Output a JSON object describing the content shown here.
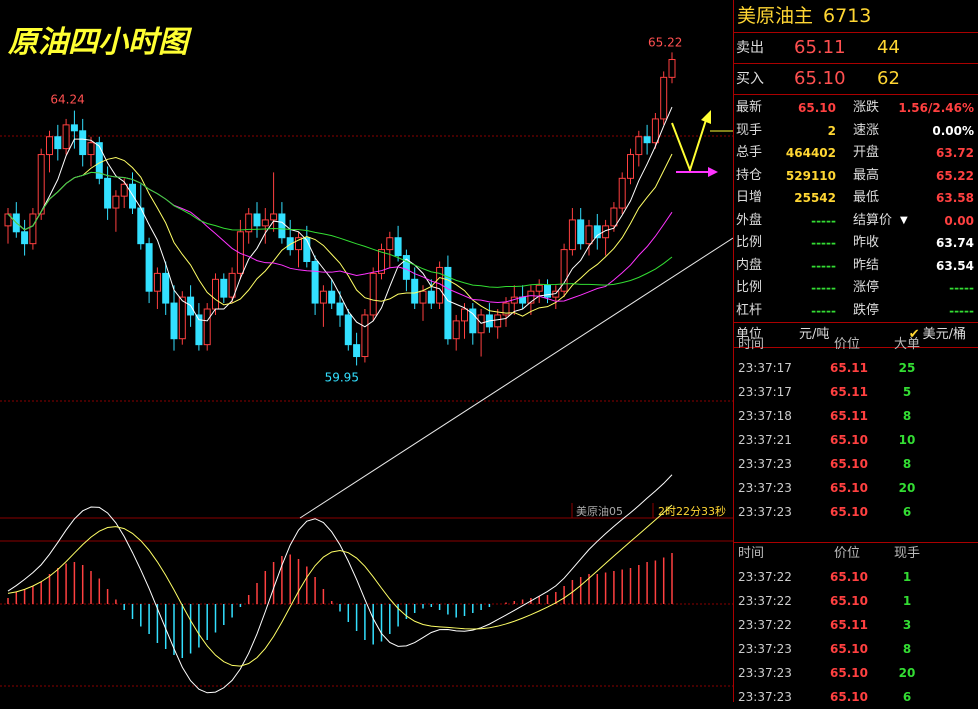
{
  "chart_data": [
    {
      "type": "candlestick",
      "title": "原油四小时图",
      "legend_label": "美原油05",
      "countdown": "2时22分33秒",
      "high_label": "64.24",
      "high2_label": "65.22",
      "low_label": "59.95",
      "candles": [
        [
          62.3,
          62.6,
          62.0,
          62.5
        ],
        [
          62.5,
          62.7,
          62.1,
          62.2
        ],
        [
          62.2,
          62.4,
          61.8,
          62.0
        ],
        [
          62.0,
          62.6,
          61.9,
          62.5
        ],
        [
          62.5,
          63.6,
          62.4,
          63.5
        ],
        [
          63.5,
          63.9,
          63.2,
          63.8
        ],
        [
          63.8,
          64.0,
          63.4,
          63.6
        ],
        [
          63.6,
          64.1,
          63.5,
          64.0
        ],
        [
          64.0,
          64.24,
          63.6,
          63.9
        ],
        [
          63.9,
          64.1,
          63.3,
          63.5
        ],
        [
          63.5,
          63.8,
          63.3,
          63.7
        ],
        [
          63.7,
          63.8,
          63.0,
          63.1
        ],
        [
          63.1,
          63.3,
          62.4,
          62.6
        ],
        [
          62.6,
          62.9,
          62.2,
          62.8
        ],
        [
          62.8,
          63.1,
          62.6,
          63.0
        ],
        [
          63.0,
          63.2,
          62.5,
          62.6
        ],
        [
          62.6,
          63.0,
          61.9,
          62.0
        ],
        [
          62.0,
          62.1,
          61.0,
          61.2
        ],
        [
          61.2,
          61.6,
          60.9,
          61.5
        ],
        [
          61.5,
          61.7,
          60.8,
          61.0
        ],
        [
          61.0,
          61.3,
          60.2,
          60.4
        ],
        [
          60.4,
          61.2,
          60.3,
          61.1
        ],
        [
          61.1,
          61.3,
          60.6,
          60.8
        ],
        [
          60.8,
          61.0,
          60.2,
          60.3
        ],
        [
          60.3,
          61.0,
          60.2,
          60.9
        ],
        [
          60.9,
          61.5,
          60.8,
          61.4
        ],
        [
          61.4,
          61.5,
          61.0,
          61.1
        ],
        [
          61.1,
          61.6,
          61.0,
          61.5
        ],
        [
          61.5,
          62.4,
          61.4,
          62.2
        ],
        [
          62.2,
          62.6,
          62.0,
          62.5
        ],
        [
          62.5,
          62.7,
          62.1,
          62.3
        ],
        [
          62.3,
          62.6,
          62.0,
          62.4
        ],
        [
          62.4,
          63.2,
          62.2,
          62.5
        ],
        [
          62.5,
          62.7,
          62.0,
          62.1
        ],
        [
          62.1,
          62.4,
          61.8,
          61.9
        ],
        [
          61.9,
          62.2,
          61.6,
          62.1
        ],
        [
          62.1,
          62.3,
          61.6,
          61.7
        ],
        [
          61.7,
          61.8,
          60.8,
          61.0
        ],
        [
          61.0,
          61.3,
          60.6,
          61.2
        ],
        [
          61.2,
          61.4,
          60.9,
          61.0
        ],
        [
          61.0,
          61.2,
          60.6,
          60.8
        ],
        [
          60.8,
          60.9,
          60.2,
          60.3
        ],
        [
          60.3,
          60.5,
          59.95,
          60.1
        ],
        [
          60.1,
          60.9,
          60.0,
          60.8
        ],
        [
          60.8,
          61.6,
          60.7,
          61.5
        ],
        [
          61.5,
          62.0,
          61.4,
          61.9
        ],
        [
          61.9,
          62.2,
          61.6,
          62.1
        ],
        [
          62.1,
          62.3,
          61.7,
          61.8
        ],
        [
          61.8,
          61.9,
          61.2,
          61.4
        ],
        [
          61.4,
          61.6,
          60.9,
          61.0
        ],
        [
          61.0,
          61.3,
          60.7,
          61.2
        ],
        [
          61.2,
          61.4,
          60.9,
          61.0
        ],
        [
          61.0,
          61.7,
          60.9,
          61.6
        ],
        [
          61.6,
          61.8,
          60.3,
          60.4
        ],
        [
          60.4,
          60.8,
          60.2,
          60.7
        ],
        [
          60.7,
          61.0,
          60.4,
          60.9
        ],
        [
          60.9,
          61.0,
          60.3,
          60.5
        ],
        [
          60.5,
          60.9,
          60.1,
          60.8
        ],
        [
          60.8,
          61.0,
          60.5,
          60.6
        ],
        [
          60.6,
          60.9,
          60.4,
          60.8
        ],
        [
          60.8,
          61.1,
          60.6,
          61.0
        ],
        [
          61.0,
          61.3,
          60.8,
          61.1
        ],
        [
          61.1,
          61.3,
          60.9,
          61.0
        ],
        [
          61.0,
          61.3,
          60.8,
          61.2
        ],
        [
          61.2,
          61.4,
          61.0,
          61.3
        ],
        [
          61.3,
          61.4,
          61.0,
          61.1
        ],
        [
          61.1,
          61.3,
          60.9,
          61.2
        ],
        [
          61.2,
          62.0,
          61.1,
          61.9
        ],
        [
          61.9,
          62.6,
          61.8,
          62.4
        ],
        [
          62.4,
          62.6,
          61.9,
          62.0
        ],
        [
          62.0,
          62.4,
          61.8,
          62.3
        ],
        [
          62.3,
          62.5,
          61.9,
          62.1
        ],
        [
          62.1,
          62.4,
          61.8,
          62.3
        ],
        [
          62.3,
          62.7,
          62.2,
          62.6
        ],
        [
          62.6,
          63.2,
          62.5,
          63.1
        ],
        [
          63.1,
          63.6,
          63.0,
          63.5
        ],
        [
          63.5,
          63.9,
          63.3,
          63.8
        ],
        [
          63.8,
          64.0,
          63.5,
          63.7
        ],
        [
          63.7,
          64.2,
          63.6,
          64.1
        ],
        [
          64.1,
          64.9,
          64.0,
          64.8
        ],
        [
          64.8,
          65.22,
          64.7,
          65.1
        ]
      ]
    },
    {
      "type": "bar",
      "title": "MACD",
      "values": [
        0.04,
        0.08,
        0.1,
        0.12,
        0.15,
        0.2,
        0.24,
        0.27,
        0.28,
        0.26,
        0.22,
        0.17,
        0.1,
        0.03,
        -0.04,
        -0.1,
        -0.15,
        -0.2,
        -0.26,
        -0.3,
        -0.34,
        -0.36,
        -0.33,
        -0.29,
        -0.24,
        -0.19,
        -0.14,
        -0.09,
        -0.02,
        0.06,
        0.14,
        0.22,
        0.28,
        0.32,
        0.33,
        0.3,
        0.25,
        0.18,
        0.1,
        0.02,
        -0.05,
        -0.12,
        -0.18,
        -0.24,
        -0.27,
        -0.25,
        -0.2,
        -0.15,
        -0.1,
        -0.06,
        -0.03,
        -0.02,
        -0.04,
        -0.07,
        -0.09,
        -0.08,
        -0.06,
        -0.04,
        -0.02,
        0.0,
        0.01,
        0.02,
        0.03,
        0.04,
        0.05,
        0.06,
        0.08,
        0.12,
        0.16,
        0.18,
        0.2,
        0.2,
        0.21,
        0.22,
        0.23,
        0.24,
        0.26,
        0.28,
        0.29,
        0.31,
        0.34
      ]
    }
  ],
  "panel": {
    "title": "美原油主",
    "code": "6713",
    "sell_label": "卖出",
    "sell_price": "65.11",
    "sell_vol": "44",
    "buy_label": "买入",
    "buy_price": "65.10",
    "buy_vol": "62",
    "stats": [
      [
        "最新",
        "65.10",
        "涨跌",
        "1.56/2.46%"
      ],
      [
        "现手",
        "2",
        "速涨",
        "0.00%"
      ],
      [
        "总手",
        "464402",
        "开盘",
        "63.72"
      ],
      [
        "持仓",
        "529110",
        "最高",
        "65.22"
      ],
      [
        "日增",
        "25542",
        "最低",
        "63.58"
      ],
      [
        "外盘",
        "-----",
        "结算价",
        "0.00"
      ],
      [
        "比例",
        "-----",
        "昨收",
        "63.74"
      ],
      [
        "内盘",
        "-----",
        "昨结",
        "63.54"
      ],
      [
        "比例",
        "-----",
        "涨停",
        "-----"
      ],
      [
        "杠杆",
        "-----",
        "跌停",
        "-----"
      ]
    ],
    "unit_label": "单位",
    "unit_value": "元/吨",
    "unit_alt": "美元/桶",
    "unit_check": "✔",
    "ticks1_headers": [
      "时间",
      "价位",
      "大单"
    ],
    "ticks1": [
      [
        "23:37:17",
        "65.11",
        "25"
      ],
      [
        "23:37:17",
        "65.11",
        "5"
      ],
      [
        "23:37:18",
        "65.11",
        "8"
      ],
      [
        "23:37:21",
        "65.10",
        "10"
      ],
      [
        "23:37:23",
        "65.10",
        "8"
      ],
      [
        "23:37:23",
        "65.10",
        "20"
      ],
      [
        "23:37:23",
        "65.10",
        "6"
      ]
    ],
    "ticks2_headers": [
      "时间",
      "价位",
      "现手"
    ],
    "ticks2": [
      [
        "23:37:22",
        "65.10",
        "1"
      ],
      [
        "23:37:22",
        "65.10",
        "1"
      ],
      [
        "23:37:22",
        "65.11",
        "3"
      ],
      [
        "23:37:23",
        "65.10",
        "8"
      ],
      [
        "23:37:23",
        "65.10",
        "20"
      ],
      [
        "23:37:23",
        "65.10",
        "6"
      ]
    ]
  },
  "colors": {
    "up": "#ff4040",
    "down": "#33e0ff",
    "ma5": "#ffffff",
    "ma10": "#ffff66",
    "ma20": "#ff33ff",
    "ma60": "#33dd33",
    "yellow": "#ffd633"
  }
}
